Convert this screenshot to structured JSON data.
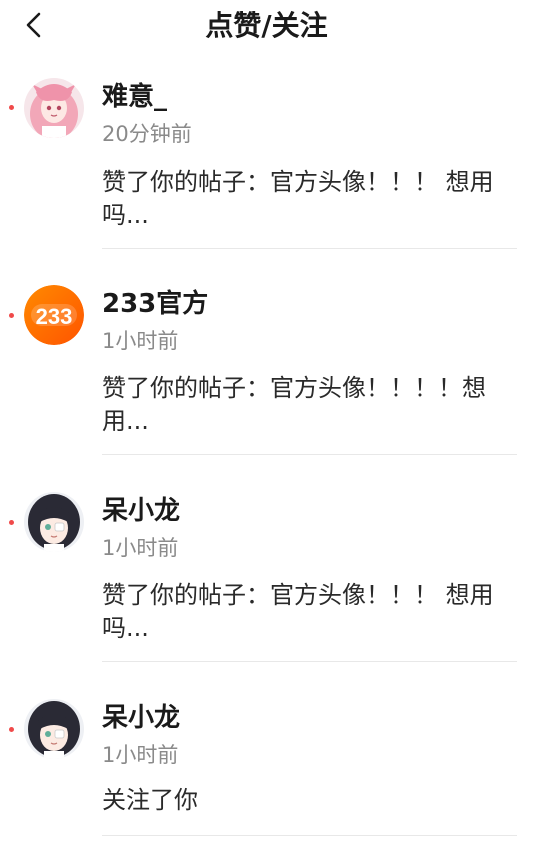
{
  "header": {
    "title": "点赞/关注",
    "back_icon": "chevron-left-icon"
  },
  "colors": {
    "unread_dot": "#f04a4a",
    "time_text": "#8a8a8a",
    "divider": "#e8e8e8",
    "badge_orange": "#ff6a00"
  },
  "notifications": [
    {
      "username": "难意_",
      "time": "20分钟前",
      "content": "赞了你的帖子：官方头像！！！ 想用吗...",
      "unread": true,
      "avatar": "pink-anime-girl-avatar"
    },
    {
      "username": "233官方",
      "time": "1小时前",
      "content": "赞了你的帖子：官方头像！！！！想用...",
      "unread": true,
      "avatar": "233-logo-avatar",
      "avatar_text": "233"
    },
    {
      "username": "呆小龙",
      "time": "1小时前",
      "content": "赞了你的帖子：官方头像！！！ 想用吗...",
      "unread": true,
      "avatar": "dark-hair-anime-girl-avatar"
    },
    {
      "username": "呆小龙",
      "time": "1小时前",
      "content": "关注了你",
      "unread": true,
      "avatar": "dark-hair-anime-girl-avatar"
    }
  ]
}
